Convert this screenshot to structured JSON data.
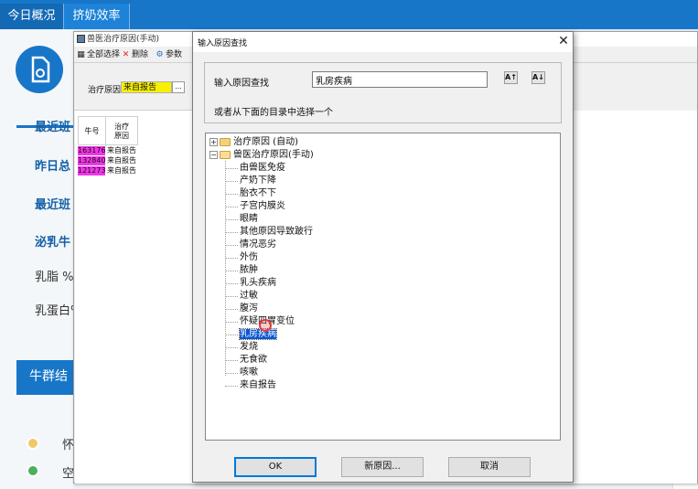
{
  "dashboard": {
    "tabs": [
      {
        "label": "今日概况"
      },
      {
        "label": "挤奶效率"
      }
    ],
    "labels": [
      "最近班",
      "昨日总",
      "最近班",
      "泌乳牛",
      "乳脂 %",
      "乳蛋白%"
    ],
    "herd_title": "牛群结",
    "legend": [
      "怀",
      "空"
    ],
    "colors": {
      "primary": "#1776c8",
      "accent_orange": "#e8662a"
    }
  },
  "treatment_window": {
    "title": "兽医治疗原因(手动)",
    "toolbar": [
      {
        "label": "全部选择",
        "icon": "select-all-icon"
      },
      {
        "label": "删除",
        "icon": "delete-x-icon"
      },
      {
        "label": "参数",
        "icon": "params-icon"
      }
    ],
    "filter": {
      "label": "治疗原因",
      "value": "来自报告",
      "button": "..."
    },
    "grid": {
      "columns": [
        "牛号",
        "治疗\n原因"
      ],
      "rows": [
        {
          "cow": "163176",
          "reason": "来自报告"
        },
        {
          "cow": "132840",
          "reason": "来自报告"
        },
        {
          "cow": "121273",
          "reason": "来自报告"
        }
      ]
    }
  },
  "dialog": {
    "title": "输入原因查找",
    "search": {
      "label": "输入原因查找",
      "value": "乳房疾病"
    },
    "sort_buttons": [
      "A↑",
      "A↓"
    ],
    "hint": "或者从下面的目录中选择一个",
    "tree": {
      "roots": [
        {
          "label": "治疗原因 (自动)",
          "expanded": false
        },
        {
          "label": "兽医治疗原因(手动)",
          "expanded": true
        }
      ],
      "children": [
        "由兽医免疫",
        "产奶下降",
        "胎衣不下",
        "子宫内膜炎",
        "眼睛",
        "其他原因导致跛行",
        "情况恶劣",
        "外伤",
        "脓肿",
        "乳头疾病",
        "过敏",
        "腹泻",
        "怀疑四胃变位",
        "乳房疾病",
        "发烧",
        "无食欲",
        "咳嗽",
        "来自报告"
      ],
      "selected": "乳房疾病"
    },
    "buttons": {
      "ok": "OK",
      "new": "新原因...",
      "cancel": "取消"
    }
  }
}
